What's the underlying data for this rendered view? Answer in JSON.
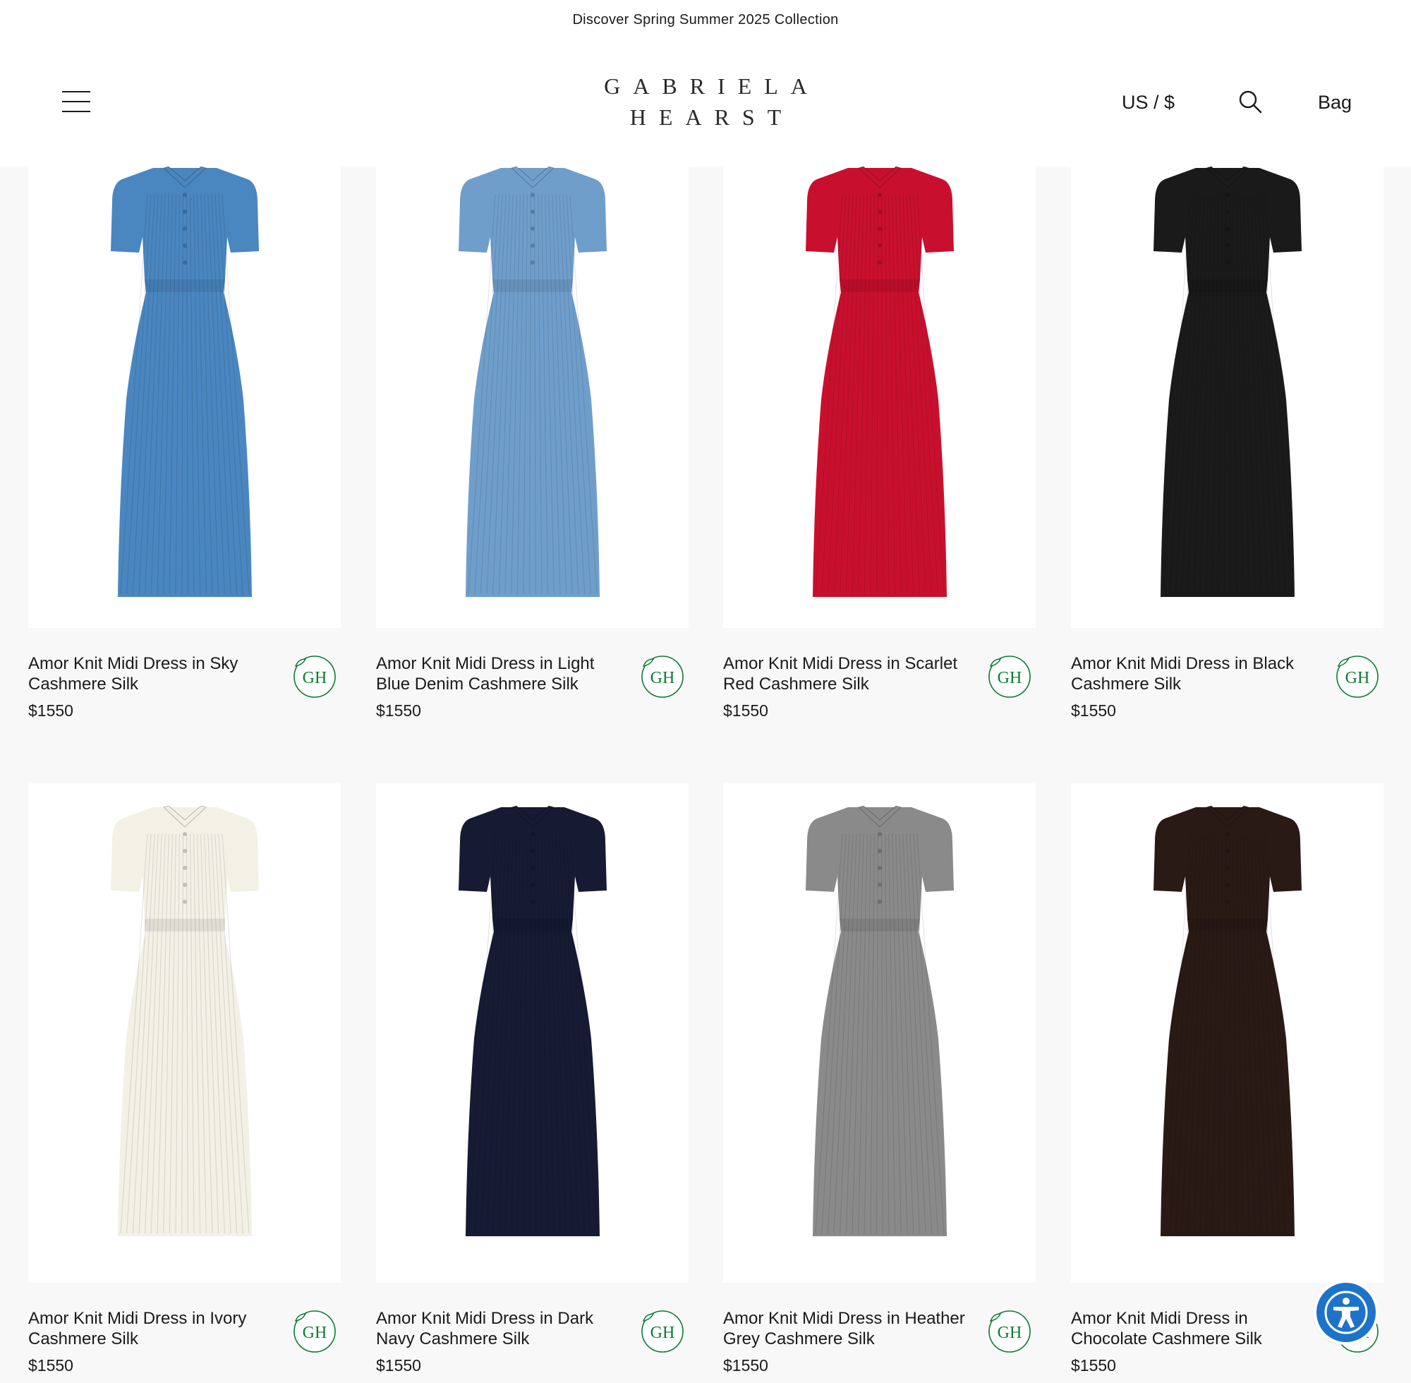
{
  "announcement": "Discover Spring Summer 2025 Collection",
  "header": {
    "logo_line1": "GABRIELA",
    "logo_line2": "HEARST",
    "locale": "US / $",
    "bag": "Bag",
    "icons": {
      "menu": "hamburger-menu-icon",
      "search": "search-icon"
    }
  },
  "badge_text": "GH",
  "accessibility_icon": "accessibility-icon",
  "products": [
    {
      "name": "Amor Knit Midi Dress in Sky Cashmere Silk",
      "price": "$1550",
      "color": "#4a86bf",
      "collar": "#4a86bf"
    },
    {
      "name": "Amor Knit Midi Dress in Light Blue Denim Cashmere Silk",
      "price": "$1550",
      "color": "#6f9ecb",
      "collar": "#6f9ecb"
    },
    {
      "name": "Amor Knit Midi Dress in Scarlet Red Cashmere Silk",
      "price": "$1550",
      "color": "#c8102e",
      "collar": "#c8102e"
    },
    {
      "name": "Amor Knit Midi Dress in Black Cashmere Silk",
      "price": "$1550",
      "color": "#1a1a1a",
      "collar": "#1a1a1a"
    },
    {
      "name": "Amor Knit Midi Dress in Ivory Cashmere Silk",
      "price": "$1550",
      "color": "#f3f0e6",
      "collar": "#f3f0e6"
    },
    {
      "name": "Amor Knit Midi Dress in Dark Navy Cashmere Silk",
      "price": "$1550",
      "color": "#161b33",
      "collar": "#161b33"
    },
    {
      "name": "Amor Knit Midi Dress in Heather Grey Cashmere Silk",
      "price": "$1550",
      "color": "#8a8a8a",
      "collar": "#8a8a8a"
    },
    {
      "name": "Amor Knit Midi Dress in Chocolate Cashmere Silk",
      "price": "$1550",
      "color": "#2a1a16",
      "collar": "#2a1a16"
    }
  ]
}
